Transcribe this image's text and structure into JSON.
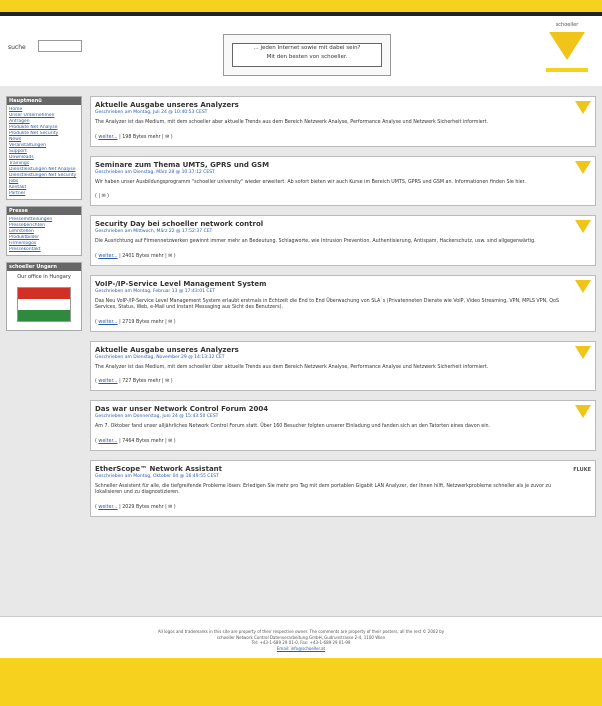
{
  "colors": {
    "brand_yellow": "#f6d21e",
    "link_blue": "#2a5ab0",
    "sidebar_head": "#666666"
  },
  "header": {
    "search_label": "suche",
    "search_value": "",
    "slogan_line1": "... jeden Internet sowie mit dabei sein?",
    "slogan_line2": "Mit den besten von schoeller.",
    "logo_text": "schoeller",
    "logo_icon": "schoeller-triangle-logo"
  },
  "sidebar": {
    "nav_title": "Hauptmenü",
    "nav_items": [
      "Home",
      "Unser Unternehmen",
      "Anfragen",
      "Produkte Net Analyse",
      "Produkte Net Security",
      "News",
      "Veranstaltungen",
      "Support",
      "Downloads",
      "Trainings",
      "Dienstleistungen Net Analyse",
      "Dienstleistungen Net Security",
      "Jobs",
      "Kontakt",
      "Partner"
    ],
    "press_title": "Presse",
    "press_items": [
      "Pressemitteilungen",
      "Presseberichten",
      "Lehrstellen",
      "Produktbilder",
      "Firmenlogos",
      "Pressekontakt"
    ],
    "office_title": "schoeller Ungarn",
    "office_text": "Our office in Hungary"
  },
  "articles": [
    {
      "title": "Aktuelle Ausgabe unseres Analyzers",
      "meta": "Geschrieben am Montag, Juli 24 @ 10:40:53 CEST",
      "body": "The Analyzer ist das Medium, mit dem schoeller aber aktuelle Trends aus dem Bereich Netzwerk Analyse, Performance Analyse und Netzwerk Sicherheit informiert.",
      "more": "weiter...",
      "foot": "| 198 Bytes mehr | ",
      "icon": "yellow-triangle-icon"
    },
    {
      "title": "Seminare zum Thema UMTS, GPRS und GSM",
      "meta": "Geschrieben am Dienstag, März 28 @ 10:37:12 CEST",
      "body": "Wir haben unser Ausbildungsprogramm \"schoeller university\" wieder erweitert. Ab sofort bieten wir auch Kurse im Bereich UMTS, GPRS und GSM an. Informationen finden Sie hier.",
      "more": "",
      "foot": "| ",
      "icon": "yellow-triangle-icon"
    },
    {
      "title": "Security Day bei schoeller network control",
      "meta": "Geschrieben am Mittwoch, März 22 @ 17:52:37 CET",
      "body": "Die Ausrichtung auf Firmennetzwerken gewinnt immer mehr an Bedeutung. Schlagworte, wie Intrusion Prevention, Authentisierung, Antispam, Hackerschutz, usw. sind allgegenwärtig.",
      "more": "weiter...",
      "foot": "| 2401 Bytes mehr | ",
      "icon": "yellow-triangle-icon"
    },
    {
      "title": "VoIP-/IP-Service Level Management System",
      "meta": "Geschrieben am Montag, Februar 13 @ 17:43:01 CET",
      "body": "Das Neu VoIP-/IP-Service Level Management System erlaubt erstmals in Echtzeit die End to End Überwachung von SLA`s (Privatenneten Dienste wie VoIP, Video Streaming, VPN, MPLS VPN, QoS Services, Status, Web, e-Mail und Instant Messaging aus Sicht des Benutzers).",
      "more": "weiter...",
      "foot": "| 2719 Bytes mehr | ",
      "icon": "yellow-triangle-icon"
    },
    {
      "title": "Aktuelle Ausgabe unseres Analyzers",
      "meta": "Geschrieben am Dienstag, November 29 @ 14:13:32 CET",
      "body": "The Analyzer ist das Medium, mit dem schoeller über aktuelle Trends aus dem Bereich Netzwerk Analyse, Performance Analyse und Netzwerk Sicherheit informiert.",
      "more": "weiter...",
      "foot": "| 727 Bytes mehr | ",
      "icon": "yellow-triangle-icon"
    },
    {
      "title": "Das war unser Network Control Forum 2004",
      "meta": "Geschrieben am Donnerstag, Juni 24 @ 15:43:50 CEST",
      "body": "Am 7. Oktober fand unser alljährliches Network Control Forum statt. Über 160 Besucher folgten unserer Einladung und fanden sich an den Tatorten eines davon ein.",
      "more": "weiter...",
      "foot": "| 7464 Bytes mehr | ",
      "icon": "yellow-triangle-icon"
    },
    {
      "title": "EtherScope™ Network Assistant",
      "meta": "Geschrieben am Montag, Oktober 04 @ 16:49:55 CEST",
      "body": "Schneller Assistent für alle, die tiefgreifende Probleme lösen: Erledigen Sie mehr pro Tag mit dem portablen Gigabit LAN Analyzer, der Ihnen hilft, Netzwerkprobleme schneller als je zuvor zu lokalisieren und zu diagnostizieren.",
      "more": "weiter...",
      "foot": "| 2029 Bytes mehr | ",
      "icon": "fluke-networks-logo"
    }
  ],
  "footer": {
    "line1": "All logos and trademarks in this site are property of their respective owner. The comments are property of their posters, all the rest © 2002 by",
    "line2": "schoeller Network Control Datenverarbeitung GmbH, Gudrunstrasse 2-4, 1100 Wien",
    "line3": "Tel: +43-1-689 29 01-0, Fax: +43-1-689 29 01-99",
    "line4": "Email: info@schoeller.at"
  }
}
